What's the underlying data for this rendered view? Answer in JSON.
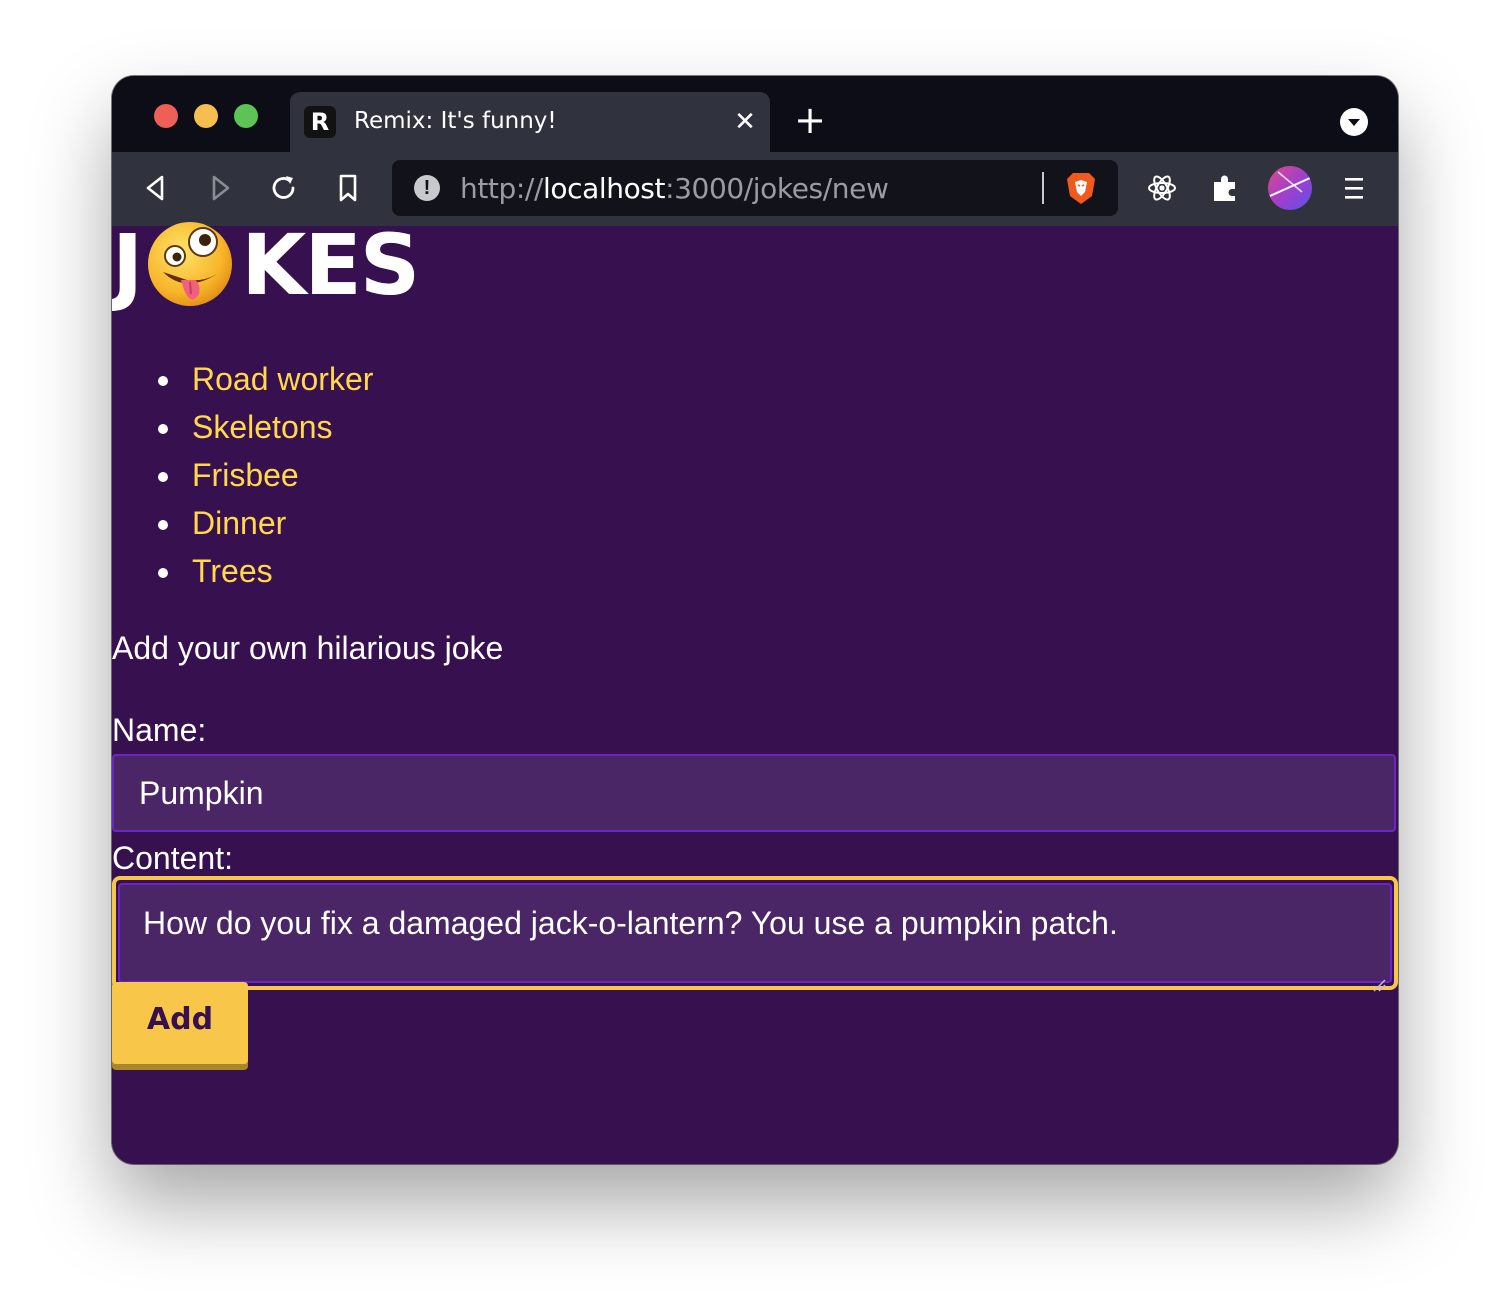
{
  "browser": {
    "tab_title": "Remix: It's funny!",
    "tab_favicon": "R",
    "tab_close": "✕",
    "new_tab": "+",
    "url_scheme": "http://",
    "url_host": "localhost",
    "url_rest": ":3000/jokes/new",
    "icons": [
      "back-icon",
      "forward-icon",
      "reload-icon",
      "bookmark-icon",
      "site-info-icon",
      "brave-shields-icon",
      "react-devtools-icon",
      "extensions-icon",
      "profile-avatar",
      "menu-icon",
      "tab-menu-icon"
    ]
  },
  "page": {
    "logo": {
      "prefix": "J",
      "suffix": "KES",
      "emoji": "zany-face-emoji"
    },
    "jokes": [
      "Road worker",
      "Skeletons",
      "Frisbee",
      "Dinner",
      "Trees"
    ],
    "subtitle": "Add your own hilarious joke",
    "form": {
      "name_label": "Name:",
      "name_value": "Pumpkin",
      "content_label": "Content:",
      "content_value": "How do you fix a damaged jack-o-lantern? You use a pumpkin patch.",
      "submit_label": "Add"
    }
  },
  "colors": {
    "page_background": "#37104f",
    "link": "#ffd94a",
    "accent": "#f8c74a",
    "input_background": "#4a2666",
    "input_border": "#6c23c8"
  }
}
